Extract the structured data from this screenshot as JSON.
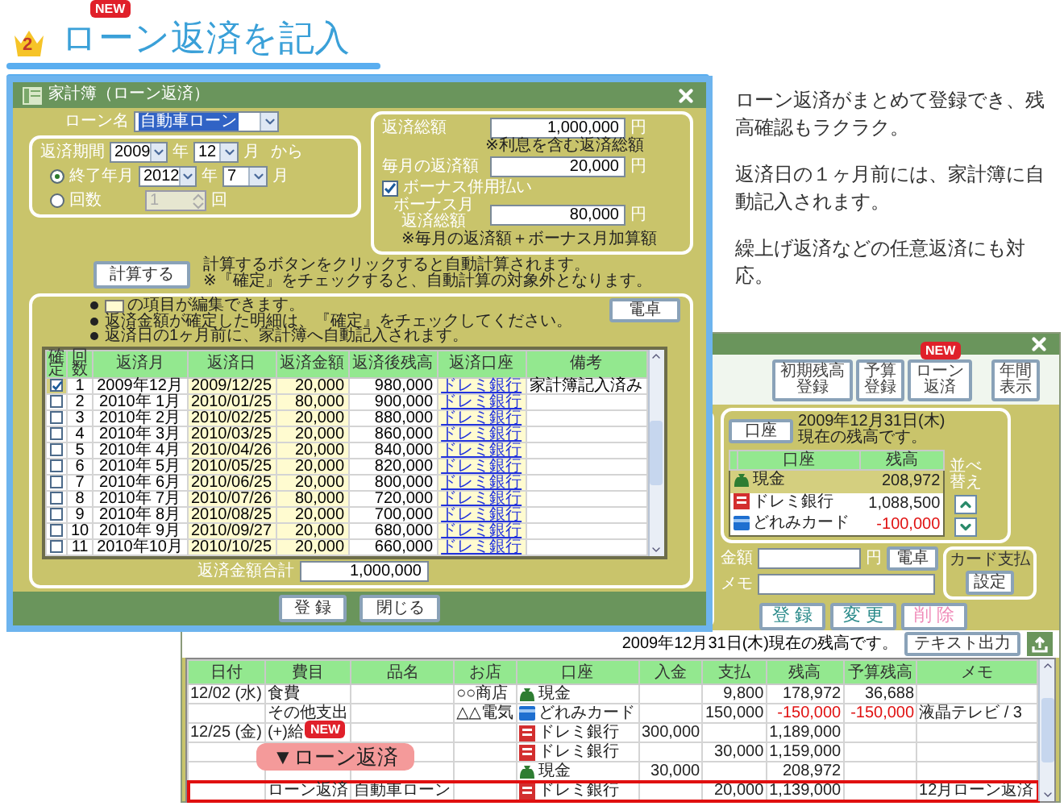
{
  "heading": {
    "rank": "2",
    "title": "ローン返済を記入",
    "badge": "NEW"
  },
  "description": [
    "ローン返済がまとめて登録でき、残高確認もラクラク。",
    "返済日の１ヶ月前には、家計簿に自動記入されます。",
    "繰上げ返済などの任意返済にも対応。"
  ],
  "dialog": {
    "title": "家計簿（ローン返済）",
    "loan_name": {
      "label": "ローン名",
      "value": "自動車ローン"
    },
    "period": {
      "label": "返済期間",
      "start": [
        {
          "value": "2009",
          "unit": "年"
        },
        {
          "value": "12",
          "unit": "月"
        }
      ],
      "from": "から",
      "options": [
        {
          "kind": "date",
          "label": "終了年月",
          "selected": true,
          "fields": [
            {
              "value": "2012",
              "unit": "年"
            },
            {
              "value": "7",
              "unit": "月"
            }
          ]
        },
        {
          "kind": "count",
          "label": "回数",
          "selected": false,
          "value": "1",
          "unit": "回"
        }
      ]
    },
    "amounts": [
      {
        "label": "返済総額",
        "value": "1,000,000",
        "unit": "円",
        "note": "※利息を含む返済総額"
      },
      {
        "label": "毎月の返済額",
        "value": "20,000",
        "unit": "円"
      }
    ],
    "bonus": {
      "label": "ボーナス併用払い",
      "checked": true
    },
    "bonus_amount": {
      "label_lines": [
        "ボーナス月",
        "返済総額"
      ],
      "value": "80,000",
      "unit": "円",
      "note": "※毎月の返済額＋ボーナス月加算額"
    },
    "calc_button": "計算する",
    "calc_notes": [
      "計算するボタンをクリックすると自動計算されます。",
      "※『確定』をチェックすると、自動計算の対象外となります。"
    ],
    "notes": [
      {
        "kind": "swatch",
        "text": "の項目が編集できます。"
      },
      {
        "kind": "plain",
        "text": "返済金額が確定した明細は、『確定』をチェックしてください。"
      },
      {
        "kind": "plain",
        "text": "返済日の1ヶ月前に、家計簿へ自動記入されます。"
      }
    ],
    "calculator_button": "電卓",
    "schedule": {
      "check_column": "確定",
      "columns": [
        {
          "label": "回数",
          "kind": "index",
          "editable": false
        },
        {
          "label": "返済月",
          "kind": "center",
          "editable": false
        },
        {
          "label": "返済日",
          "kind": "center",
          "editable": true
        },
        {
          "label": "返済金額",
          "kind": "number",
          "editable": true
        },
        {
          "label": "返済後残高",
          "kind": "number",
          "editable": false
        },
        {
          "label": "返済口座",
          "kind": "link",
          "editable": true
        },
        {
          "label": "備考",
          "kind": "text",
          "editable": false
        }
      ],
      "rows": [
        {
          "confirmed": true,
          "cells": [
            "1",
            "2009年12月",
            "2009/12/25",
            "20,000",
            "980,000",
            "ドレミ銀行",
            "家計簿記入済み"
          ]
        },
        {
          "confirmed": false,
          "cells": [
            "2",
            "2010年 1月",
            "2010/01/25",
            "80,000",
            "900,000",
            "ドレミ銀行"
          ]
        },
        {
          "confirmed": false,
          "cells": [
            "3",
            "2010年 2月",
            "2010/02/25",
            "20,000",
            "880,000",
            "ドレミ銀行"
          ]
        },
        {
          "confirmed": false,
          "cells": [
            "4",
            "2010年 3月",
            "2010/03/25",
            "20,000",
            "860,000",
            "ドレミ銀行"
          ]
        },
        {
          "confirmed": false,
          "cells": [
            "5",
            "2010年 4月",
            "2010/04/26",
            "20,000",
            "840,000",
            "ドレミ銀行"
          ]
        },
        {
          "confirmed": false,
          "cells": [
            "6",
            "2010年 5月",
            "2010/05/25",
            "20,000",
            "820,000",
            "ドレミ銀行"
          ]
        },
        {
          "confirmed": false,
          "cells": [
            "7",
            "2010年 6月",
            "2010/06/25",
            "20,000",
            "800,000",
            "ドレミ銀行"
          ]
        },
        {
          "confirmed": false,
          "cells": [
            "8",
            "2010年 7月",
            "2010/07/26",
            "80,000",
            "720,000",
            "ドレミ銀行"
          ]
        },
        {
          "confirmed": false,
          "cells": [
            "9",
            "2010年 8月",
            "2010/08/25",
            "20,000",
            "700,000",
            "ドレミ銀行"
          ]
        },
        {
          "confirmed": false,
          "cells": [
            "10",
            "2010年 9月",
            "2010/09/27",
            "20,000",
            "680,000",
            "ドレミ銀行"
          ]
        },
        {
          "confirmed": false,
          "cells": [
            "11",
            "2010年10月",
            "2010/10/25",
            "20,000",
            "660,000",
            "ドレミ銀行"
          ]
        }
      ]
    },
    "total": {
      "label": "返済金額合計",
      "value": "1,000,000"
    },
    "buttons": [
      "登 録",
      "閉じる"
    ]
  },
  "app_window": {
    "toolbar": [
      {
        "lines": [
          "初期残高",
          "登録"
        ]
      },
      {
        "lines": [
          "予算",
          "登録"
        ]
      },
      {
        "lines": [
          "ローン",
          "返済"
        ],
        "badge": "NEW"
      },
      {
        "lines": [
          "年間",
          "表示"
        ]
      }
    ],
    "accounts": {
      "button": "口座",
      "as_of": [
        "2009年12月31日(木)",
        "現在の残高です。"
      ],
      "columns": [
        "口座",
        "残高"
      ],
      "rows": [
        {
          "kind": "cash",
          "name": "現金",
          "balance": "208,972",
          "negative": false,
          "selected": true
        },
        {
          "kind": "bank",
          "name": "ドレミ銀行",
          "balance": "1,088,500",
          "negative": false,
          "selected": false
        },
        {
          "kind": "card",
          "name": "どれみカード",
          "balance": "-100,000",
          "negative": true,
          "selected": false
        }
      ],
      "sort_label": "並べ替え"
    },
    "amount": {
      "label": "金額",
      "unit": "円",
      "button": "電卓"
    },
    "card_payment": {
      "label": "カード支払",
      "button": "設定"
    },
    "memo": {
      "label": "メモ"
    },
    "actions": [
      {
        "label": "登 録",
        "disabled": false
      },
      {
        "label": "変 更",
        "disabled": false
      },
      {
        "label": "削 除",
        "disabled": true
      }
    ],
    "balance_note": "2009年12月31日(木)現在の残高です。",
    "export_button": "テキスト出力",
    "ledger": {
      "columns": [
        "日付",
        "費目",
        "品名",
        "お店",
        "口座",
        "入金",
        "支払",
        "残高",
        "予算残高",
        "メモ"
      ],
      "rows": [
        {
          "date": "12/02 (水)",
          "category": "食費",
          "shop": "○○商店",
          "account": {
            "kind": "cash",
            "name": "現金"
          },
          "payment": "9,800",
          "balance": "178,972",
          "budget": "36,688",
          "negative": false,
          "highlighted": false
        },
        {
          "category": "その他支出",
          "shop": "△△電気",
          "account": {
            "kind": "card",
            "name": "どれみカード"
          },
          "payment": "150,000",
          "balance": "-150,000",
          "budget": "-150,000",
          "memo": "液晶テレビ / 3",
          "negative": true,
          "highlighted": false
        },
        {
          "date": "12/25 (金)",
          "category": "(+)給",
          "account": {
            "kind": "bank",
            "name": "ドレミ銀行"
          },
          "deposit": "300,000",
          "balance": "1,189,000",
          "negative": false,
          "highlighted": false,
          "callout": {
            "badge": "NEW",
            "label": "▼ローン返済"
          }
        },
        {
          "account": {
            "kind": "bank",
            "name": "ドレミ銀行"
          },
          "payment": "30,000",
          "balance": "1,159,000",
          "negative": false,
          "highlighted": false
        },
        {
          "account": {
            "kind": "cash",
            "name": "現金"
          },
          "deposit": "30,000",
          "balance": "208,972",
          "negative": false,
          "highlighted": false
        },
        {
          "category": "ローン返済",
          "item": "自動車ローン",
          "account": {
            "kind": "bank",
            "name": "ドレミ銀行"
          },
          "payment": "20,000",
          "balance": "1,139,000",
          "memo": "12月ローン返済",
          "negative": false,
          "highlighted": true
        }
      ]
    }
  }
}
